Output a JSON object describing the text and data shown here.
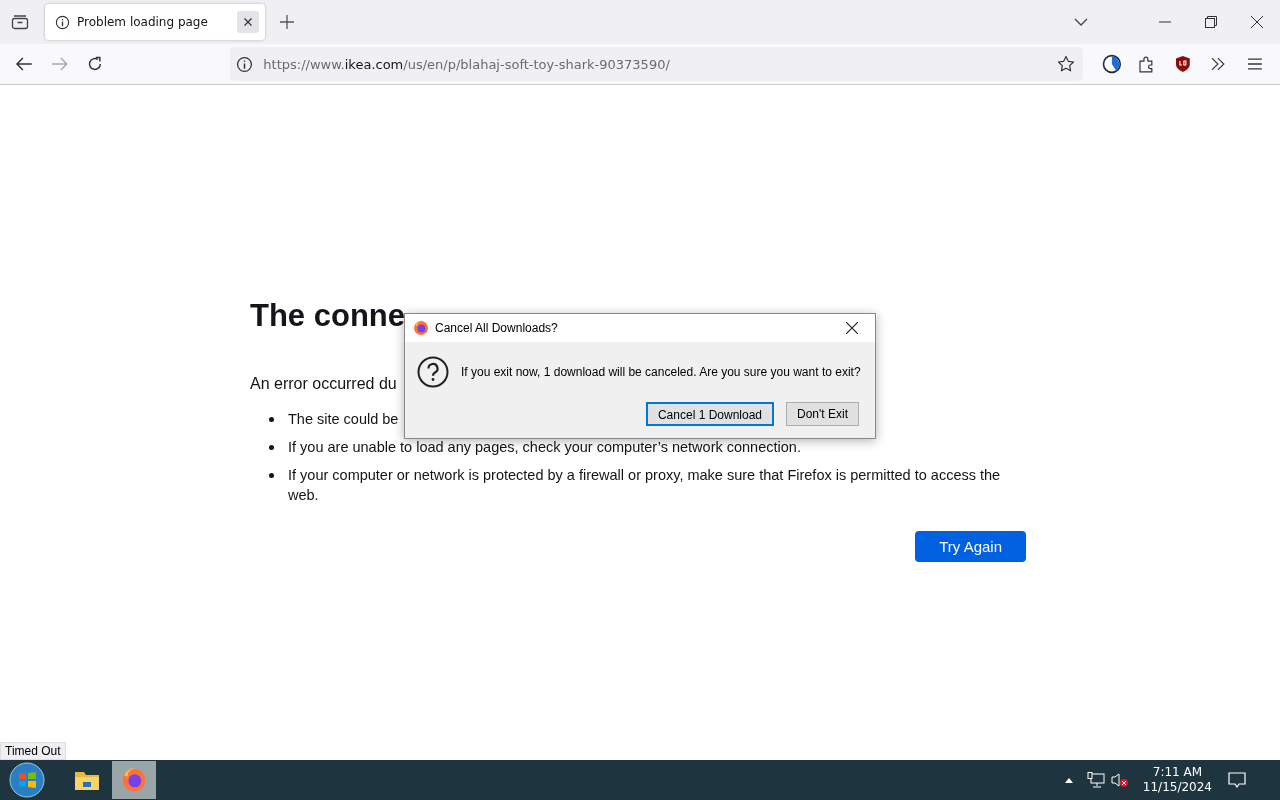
{
  "browser": {
    "tab": {
      "title": "Problem loading page",
      "selected": true
    },
    "url": {
      "prefix": "https://www.",
      "host": "ikea.com",
      "path": "/us/en/p/blahaj-soft-toy-shark-90373590/"
    }
  },
  "error_page": {
    "title": "The conne",
    "intro": "An error occurred du",
    "bullets": [
      "The site could be",
      "If you are unable to load any pages, check your computer’s network connection.",
      "If your computer or network is protected by a firewall or proxy, make sure that Firefox is permitted to access the web."
    ],
    "button": "Try Again"
  },
  "dialog": {
    "title": "Cancel All Downloads?",
    "message": "If you exit now, 1 download will be canceled. Are you sure you want to exit?",
    "buttons": [
      {
        "label": "Cancel 1 Download",
        "selected": true
      },
      {
        "label": "Don't Exit",
        "selected": false
      }
    ]
  },
  "status_text": "Timed Out",
  "taskbar": {
    "time": "7:11 AM",
    "date": "11/15/2024"
  }
}
